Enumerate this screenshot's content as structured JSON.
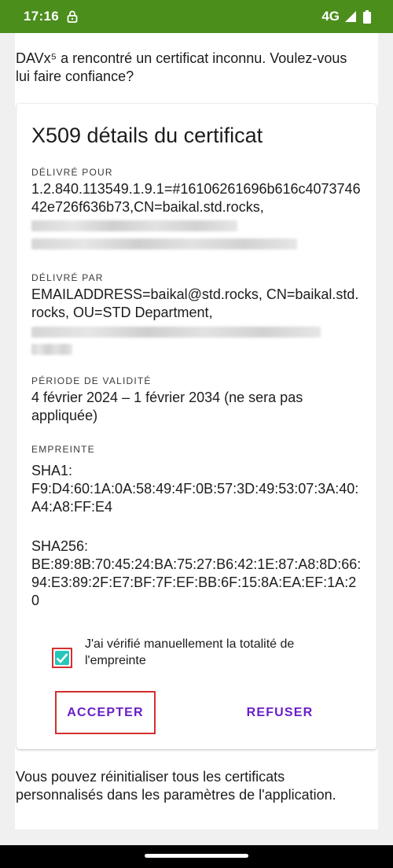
{
  "status_bar": {
    "time": "17:16",
    "network": "4G",
    "lock_icon": "lock-icon",
    "signal_icon": "signal-icon",
    "battery_icon": "battery-icon"
  },
  "dialog": {
    "intro": "DAVx⁵ a rencontré un certificat inconnu. Voulez-vous lui faire confiance?",
    "card": {
      "title": "X509 détails du certificat",
      "issued_for": {
        "label": "DÉLIVRÉ POUR",
        "value": "1.2.840.113549.1.9.1=#16106261696b616c407374642e726f636b73,CN=baikal.std.rocks,"
      },
      "issued_by": {
        "label": "DÉLIVRÉ PAR",
        "value": "EMAILADDRESS=baikal@std.rocks, CN=baikal.std.rocks, OU=STD Department,"
      },
      "validity": {
        "label": "PÉRIODE DE VALIDITÉ",
        "value": "4 février 2024 – 1 février 2034 (ne sera pas appliquée)"
      },
      "fingerprint": {
        "label": "EMPREINTE",
        "sha1": "SHA1:\nF9:D4:60:1A:0A:58:49:4F:0B:57:3D:49:53:07:3A:40:A4:A8:FF:E4",
        "sha256": "SHA256:\nBE:89:8B:70:45:24:BA:75:27:B6:42:1E:87:A8:8D:66:94:E3:89:2F:E7:BF:7F:EF:BB:6F:15:8A:EA:EF:1A:20"
      },
      "checkbox": {
        "label": "J'ai vérifié manuellement la totalité de l'empreinte",
        "checked": true,
        "color": "#26c6b8"
      },
      "buttons": {
        "accept": "ACCEPTER",
        "refuse": "REFUSER",
        "color": "#6a1fc7"
      }
    },
    "footer": "Vous pouvez réinitialiser tous les certificats personnalisés dans les paramètres de l'application."
  },
  "colors": {
    "status_bar": "#4b8e1c",
    "highlight": "#d32f2f"
  }
}
